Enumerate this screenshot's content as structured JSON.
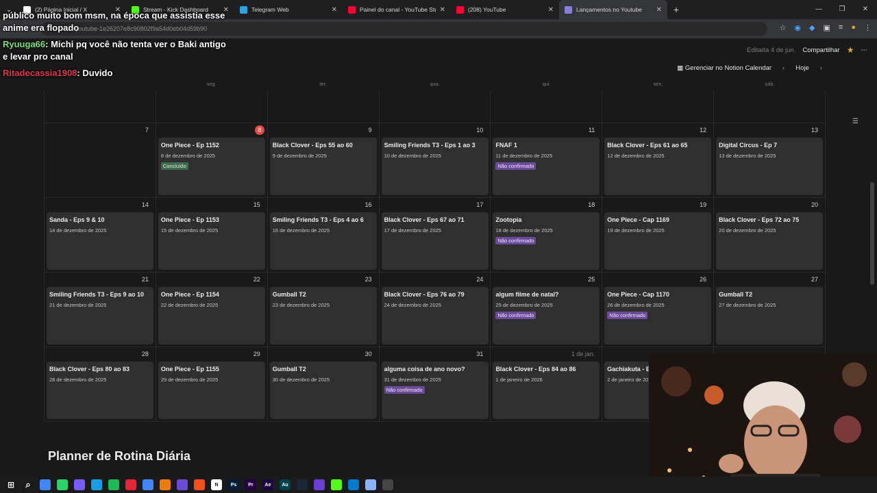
{
  "browser": {
    "tabs": [
      {
        "label": "(2) Página Inicial / X",
        "icon": "x-logo-icon",
        "color": "#ffffff"
      },
      {
        "label": "Stream - Kick Dashboard",
        "icon": "kick-icon",
        "color": "#53fc18"
      },
      {
        "label": "Telegram Web",
        "icon": "telegram-icon",
        "color": "#2aa3e0"
      },
      {
        "label": "Painel do canal - YouTube Studio",
        "icon": "youtube-studio-icon",
        "color": "#ff0033"
      },
      {
        "label": "(208) YouTube",
        "icon": "youtube-icon",
        "color": "#ff0033"
      },
      {
        "label": "Lançamentos no Youtube",
        "icon": "notion-icon",
        "color": "#8a7fd6"
      }
    ],
    "url": "youtube-1e26207e8c90802f9a54d0eb04d59b90"
  },
  "notion": {
    "edited": "Editada 4 de jun.",
    "share": "Compartilhar",
    "manage_calendar": "Gerenciar no Notion Calendar",
    "today": "Hoje",
    "weekdays": [
      "",
      "seg.",
      "ter.",
      "qua.",
      "qui.",
      "sex.",
      "sáb."
    ],
    "planner_title": "Planner de Rotina Diária"
  },
  "calendar": {
    "weeks": [
      {
        "days": [
          {
            "num": "",
            "card": null
          },
          {
            "num": "",
            "card": null
          },
          {
            "num": "",
            "card": null
          },
          {
            "num": "",
            "card": null
          },
          {
            "num": "",
            "card": null
          },
          {
            "num": "",
            "card": null
          },
          {
            "num": "",
            "card": null
          }
        ]
      },
      {
        "days": [
          {
            "num": "7",
            "card": null
          },
          {
            "num": "8",
            "today": true,
            "card": {
              "title": "One Piece - Ep 1152",
              "date": "8 de dezembro de 2025",
              "tag": "Concluído",
              "tag_type": "done"
            }
          },
          {
            "num": "9",
            "card": {
              "title": "Black Clover - Eps 55 ao 60",
              "date": "9 de dezembro de 2025"
            }
          },
          {
            "num": "10",
            "card": {
              "title": "Smiling Friends T3 - Eps 1 ao 3",
              "date": "10 de dezembro de 2025"
            }
          },
          {
            "num": "11",
            "card": {
              "title": "FNAF 1",
              "date": "11 de dezembro de 2025",
              "tag": "Não confirmado",
              "tag_type": "pending"
            }
          },
          {
            "num": "12",
            "card": {
              "title": "Black Clover - Eps 61 ao 65",
              "date": "12 de dezembro de 2025"
            }
          },
          {
            "num": "13",
            "card": {
              "title": "Digital Circus - Ep 7",
              "date": "13 de dezembro de 2025"
            }
          }
        ]
      },
      {
        "days": [
          {
            "num": "14",
            "card": {
              "title": "Sanda - Eps 9 & 10",
              "date": "14 de dezembro de 2025"
            }
          },
          {
            "num": "15",
            "card": {
              "title": "One Piece - Ep 1153",
              "date": "15 de dezembro de 2025"
            }
          },
          {
            "num": "16",
            "card": {
              "title": "Smiling Friends T3 - Eps 4 ao 6",
              "date": "16 de dezembro de 2025"
            }
          },
          {
            "num": "17",
            "card": {
              "title": "Black Clover - Eps 67 ao 71",
              "date": "17 de dezembro de 2025"
            }
          },
          {
            "num": "18",
            "card": {
              "title": "Zootopia",
              "date": "18 de dezembro de 2025",
              "tag": "Não confirmado",
              "tag_type": "pending"
            }
          },
          {
            "num": "19",
            "card": {
              "title": "One Piece - Cap 1169",
              "date": "19 de dezembro de 2025"
            }
          },
          {
            "num": "20",
            "card": {
              "title": "Black Clover - Eps 72 ao 75",
              "date": "20 de dezembro de 2025"
            }
          }
        ]
      },
      {
        "days": [
          {
            "num": "21",
            "card": {
              "title": "Smiling Friends T3 - Eps 9 ao 10",
              "date": "21 de dezembro de 2025"
            }
          },
          {
            "num": "22",
            "card": {
              "title": "One Piece - Ep 1154",
              "date": "22 de dezembro de 2025"
            }
          },
          {
            "num": "23",
            "card": {
              "title": "Gumball T2",
              "date": "23 de dezembro de 2025"
            }
          },
          {
            "num": "24",
            "card": {
              "title": "Black Clover - Eps 76 ao 79",
              "date": "24 de dezembro de 2025"
            }
          },
          {
            "num": "25",
            "card": {
              "title": "algum filme de natal?",
              "date": "25 de dezembro de 2025",
              "tag": "Não confirmado",
              "tag_type": "pending"
            }
          },
          {
            "num": "26",
            "card": {
              "title": "One Piece - Cap 1170",
              "date": "26 de dezembro de 2025",
              "tag": "Não confirmado",
              "tag_type": "pending"
            }
          },
          {
            "num": "27",
            "card": {
              "title": "Gumball T2",
              "date": "27 de dezembro de 2025"
            }
          }
        ]
      },
      {
        "days": [
          {
            "num": "28",
            "card": {
              "title": "Black Clover - Eps 80 ao 83",
              "date": "28 de dezembro de 2025"
            }
          },
          {
            "num": "29",
            "card": {
              "title": "One Piece - Ep 1155",
              "date": "29 de dezembro de 2025"
            }
          },
          {
            "num": "30",
            "card": {
              "title": "Gumball T2",
              "date": "30 de dezembro de 2025"
            }
          },
          {
            "num": "31",
            "card": {
              "title": "alguma coisa de ano novo?",
              "date": "31 de dezembro de 2025",
              "tag": "Não confirmado",
              "tag_type": "pending"
            }
          },
          {
            "num": "1 de jan.",
            "dim": true,
            "card": {
              "title": "Black Clover - Eps 84 ao 86",
              "date": "1 de janeiro de 2026"
            }
          },
          {
            "num": "",
            "card": {
              "title": "Gachiakuta - E",
              "date": "2 de janeiro de 20"
            }
          },
          {
            "num": "",
            "card": null
          }
        ]
      }
    ]
  },
  "chat": {
    "messages": [
      {
        "user": "",
        "text": "público muito bom msm, na época que assistia esse anime era flopado"
      },
      {
        "user": "Ryuuga66",
        "text": ": Michi pq você não tenta ver o Baki antigo e levar pro canal"
      },
      {
        "user": "Ritadecassia1908",
        "text": ": Duvido"
      }
    ]
  },
  "taskbar": {
    "icons": [
      {
        "name": "windows-start-icon",
        "color": "#2b8de0",
        "label": ""
      },
      {
        "name": "search-icon",
        "color": "#1a1a1a",
        "label": ""
      },
      {
        "name": "chrome-icon",
        "color": "#4285f4",
        "label": ""
      },
      {
        "name": "whatsapp-icon",
        "color": "#25d366",
        "label": ""
      },
      {
        "name": "copilot-icon",
        "color": "#7a5cff",
        "label": ""
      },
      {
        "name": "edge-icon",
        "color": "#1b9de2",
        "label": ""
      },
      {
        "name": "spotify-icon",
        "color": "#1db954",
        "label": ""
      },
      {
        "name": "opera-icon",
        "color": "#e0263a",
        "label": ""
      },
      {
        "name": "chrome-active-icon",
        "color": "#4285f4",
        "label": ""
      },
      {
        "name": "blender-icon",
        "color": "#e87d0d",
        "label": ""
      },
      {
        "name": "app-icon",
        "color": "#6a4bd6",
        "label": ""
      },
      {
        "name": "figma-icon",
        "color": "#f24e1e",
        "label": ""
      },
      {
        "name": "notion-taskbar-icon",
        "color": "#ffffff",
        "label": "N"
      },
      {
        "name": "photoshop-icon",
        "color": "#001e36",
        "label": "Ps"
      },
      {
        "name": "premiere-icon",
        "color": "#2a0044",
        "label": "Pr"
      },
      {
        "name": "after-effects-icon",
        "color": "#1f0040",
        "label": "Ae"
      },
      {
        "name": "audition-icon",
        "color": "#00434a",
        "label": "Au"
      },
      {
        "name": "steam-icon",
        "color": "#1b2838",
        "label": ""
      },
      {
        "name": "obs-icon",
        "color": "#6a3fd6",
        "label": ""
      },
      {
        "name": "app2-icon",
        "color": "#53fc18",
        "label": ""
      },
      {
        "name": "vscode-icon",
        "color": "#007acc",
        "label": ""
      },
      {
        "name": "app3-icon",
        "color": "#8ab4f8",
        "label": ""
      },
      {
        "name": "app4-icon",
        "color": "#444444",
        "label": ""
      }
    ]
  }
}
